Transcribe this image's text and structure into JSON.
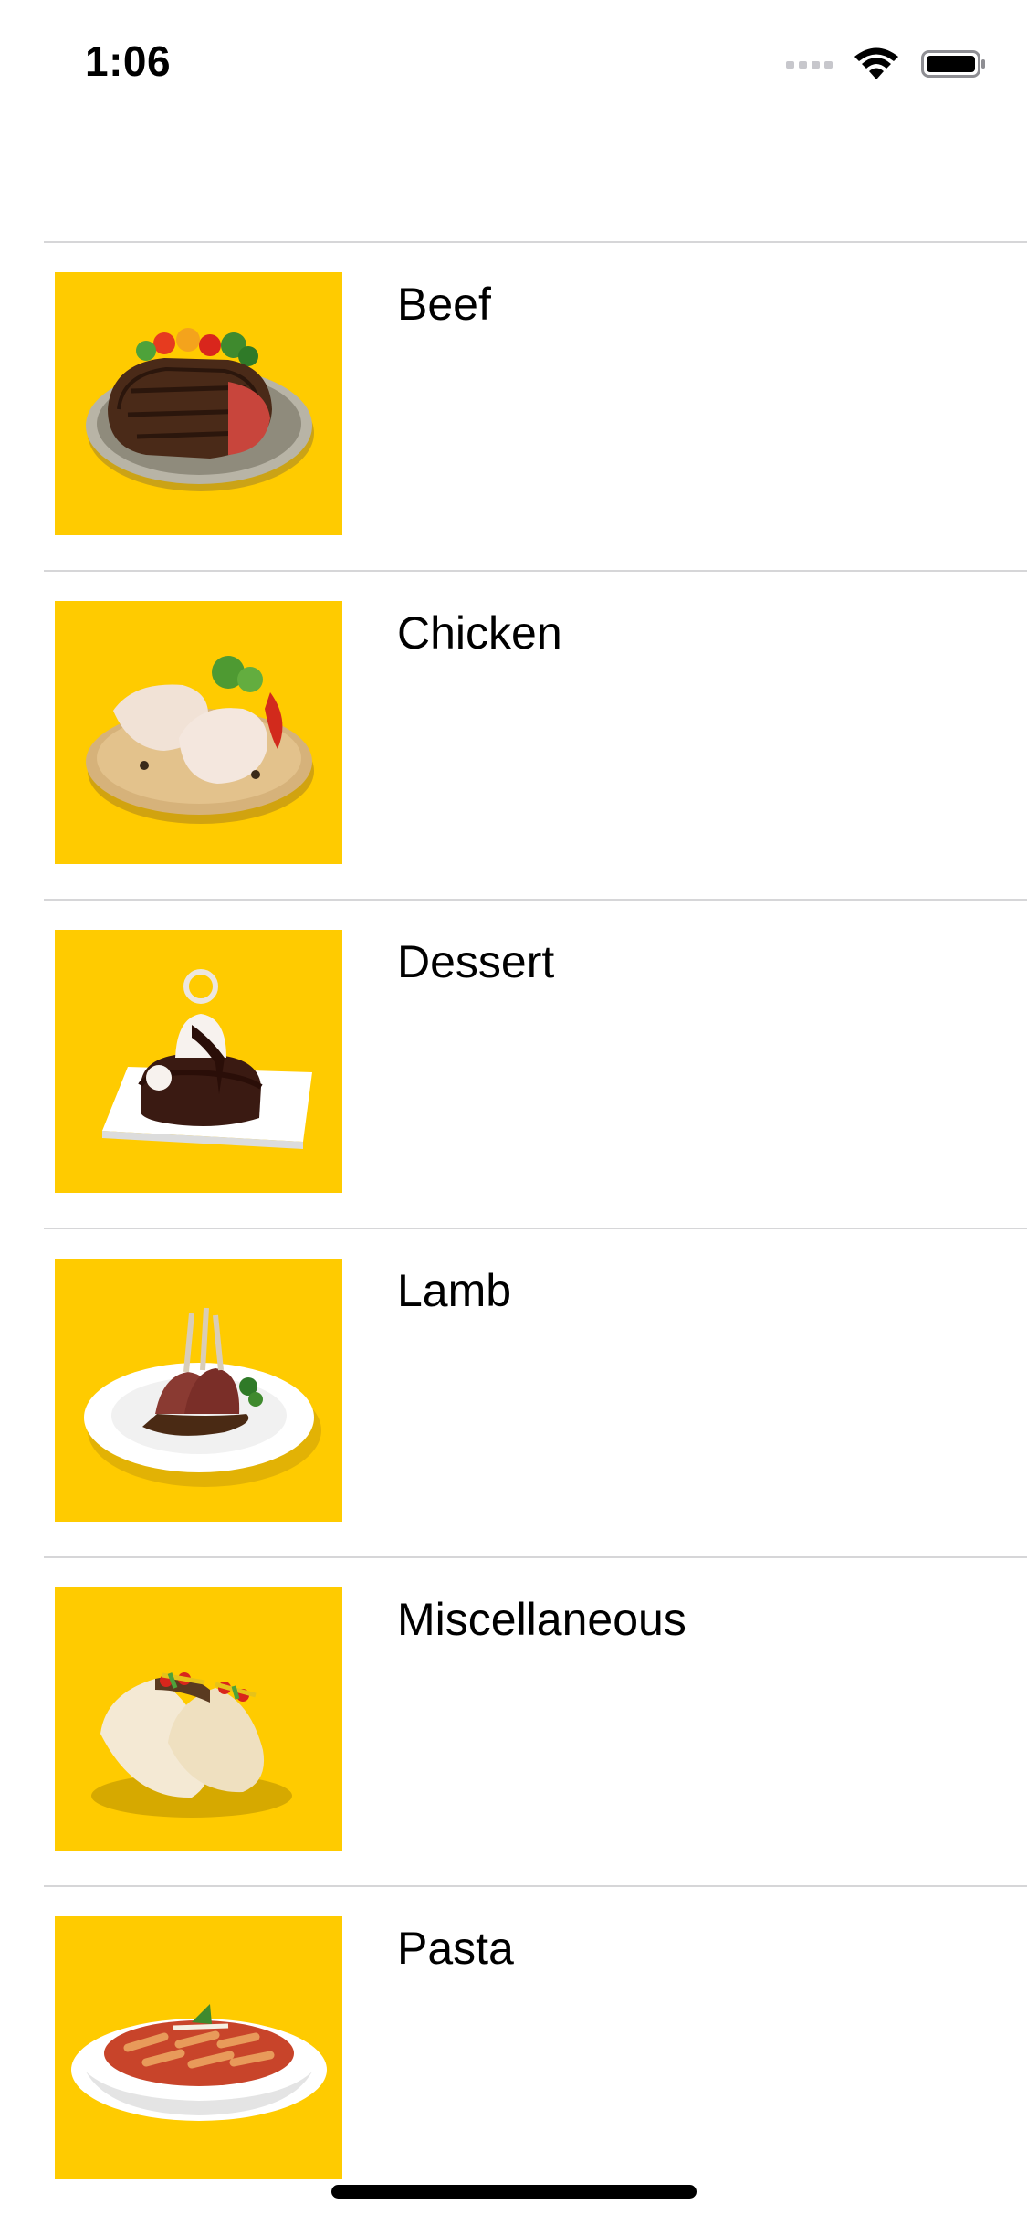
{
  "status_bar": {
    "time": "1:06",
    "icons": [
      "cellular-signal-icon",
      "wifi-icon",
      "battery-icon"
    ]
  },
  "categories": [
    {
      "label": "Beef",
      "image": "steak-plate-image"
    },
    {
      "label": "Chicken",
      "image": "raw-chicken-board-image"
    },
    {
      "label": "Dessert",
      "image": "chocolate-cake-plate-image"
    },
    {
      "label": "Lamb",
      "image": "lamb-chops-plate-image"
    },
    {
      "label": "Miscellaneous",
      "image": "tacos-image"
    },
    {
      "label": "Pasta",
      "image": "penne-pasta-bowl-image"
    }
  ],
  "colors": {
    "thumbnail_background": "#ffcb00",
    "separator": "#d6d6d8"
  }
}
